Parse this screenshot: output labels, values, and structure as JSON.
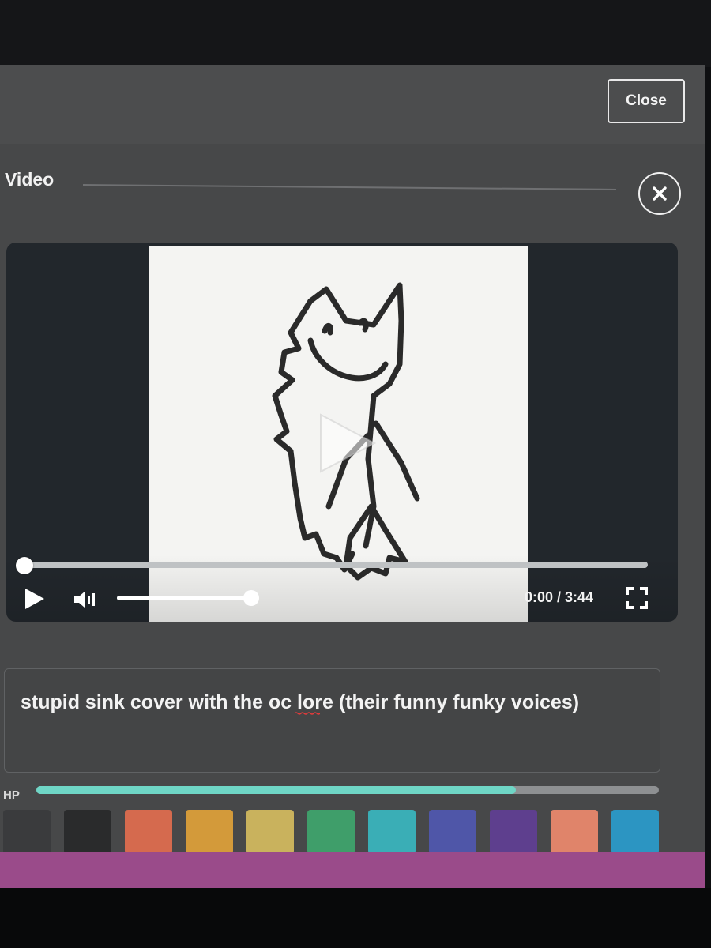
{
  "header": {
    "close_label": "Close"
  },
  "section": {
    "title": "Video"
  },
  "player": {
    "time": "0:00 / 3:44",
    "progress_fraction": 0.0,
    "volume_fraction": 1.0
  },
  "description": {
    "text": "stupid sink cover with the oc lore (their funny funky voices)"
  },
  "hp": {
    "label": "HP",
    "fraction": 0.77
  },
  "swatches": [
    {
      "color": "#3a3b3d"
    },
    {
      "color": "#2a2b2c"
    },
    {
      "color": "#d56a4e"
    },
    {
      "color": "#d39a3a"
    },
    {
      "color": "#c9b25d"
    },
    {
      "color": "#3f9e6a"
    },
    {
      "color": "#3aaeb6"
    },
    {
      "color": "#4f56a8"
    },
    {
      "color": "#5e3f8e"
    },
    {
      "color": "#e0846a"
    },
    {
      "color": "#2c95c2"
    }
  ],
  "colors": {
    "accent_hp": "#6fd6c6",
    "bottom_bar": "#9a4b8a"
  }
}
